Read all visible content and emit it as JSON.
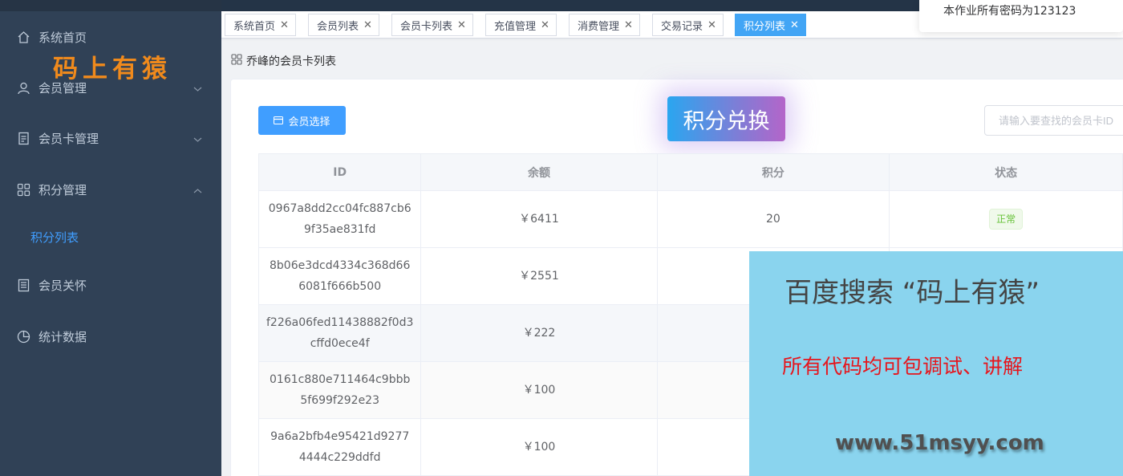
{
  "sidebar": {
    "items": [
      {
        "label": "系统首页",
        "icon": "home-icon"
      },
      {
        "label": "会员管理",
        "icon": "user-icon"
      },
      {
        "label": "会员卡管理",
        "icon": "document-icon"
      },
      {
        "label": "积分管理",
        "icon": "grid-icon"
      },
      {
        "label": "积分列表",
        "icon": ""
      },
      {
        "label": "会员关怀",
        "icon": "list-icon"
      },
      {
        "label": "统计数据",
        "icon": "pie-chart-icon"
      }
    ],
    "brand_overlay": "码上有猿"
  },
  "tabs": [
    {
      "label": "系统首页",
      "active": false
    },
    {
      "label": "会员列表",
      "active": false
    },
    {
      "label": "会员卡列表",
      "active": false
    },
    {
      "label": "充值管理",
      "active": false
    },
    {
      "label": "消费管理",
      "active": false
    },
    {
      "label": "交易记录",
      "active": false
    },
    {
      "label": "积分列表",
      "active": true
    }
  ],
  "notice": "本作业所有密码为123123",
  "breadcrumb": "乔峰的会员卡列表",
  "toolbar": {
    "member_select_label": "会员选择",
    "page_badge": "积分兑换",
    "search_placeholder": "请输入要查找的会员卡ID"
  },
  "table": {
    "columns": [
      "ID",
      "余额",
      "积分",
      "状态"
    ],
    "rows": [
      {
        "id_line1": "0967a8dd2cc04fc887cb6",
        "id_line2": "9f35ae831fd",
        "balance": "￥6411",
        "points": "20",
        "status": "正常"
      },
      {
        "id_line1": "8b06e3dcd4334c368d66",
        "id_line2": "6081f666b500",
        "balance": "￥2551",
        "points": "",
        "status": ""
      },
      {
        "id_line1": "f226a06fed11438882f0d3",
        "id_line2": "cffd0ece4f",
        "balance": "￥222",
        "points": "",
        "status": ""
      },
      {
        "id_line1": "0161c880e711464c9bbb",
        "id_line2": "5f699f292e23",
        "balance": "￥100",
        "points": "",
        "status": ""
      },
      {
        "id_line1": "9a6a2bfb4e95421d9277",
        "id_line2": "4444c229ddfd",
        "balance": "￥100",
        "points": "",
        "status": ""
      }
    ]
  },
  "ad": {
    "line1": "百度搜索 “码上有猿”",
    "line2": "所有代码均可包调试、讲解",
    "line3": "www.51msyy.com"
  },
  "colors": {
    "sidebar_bg": "#304156",
    "accent": "#409eff",
    "active_tab": "#42a5f5",
    "ad_bg": "#8ad4ee",
    "ad_red": "#e6161d",
    "brand_orange": "#f08a1c"
  }
}
